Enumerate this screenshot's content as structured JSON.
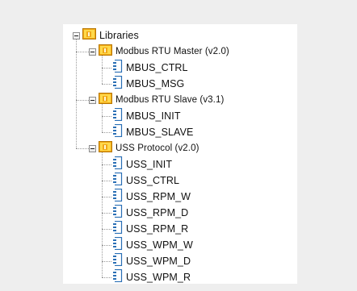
{
  "tree": {
    "root": {
      "label": "Libraries",
      "icon": "library-folder-icon",
      "expanded": true
    },
    "libraries": [
      {
        "label": "Modbus RTU Master (v2.0)",
        "icon": "library-folder-icon",
        "expanded": true,
        "blocks": [
          "MBUS_CTRL",
          "MBUS_MSG"
        ]
      },
      {
        "label": "Modbus RTU Slave (v3.1)",
        "icon": "library-folder-icon",
        "expanded": true,
        "blocks": [
          "MBUS_INIT",
          "MBUS_SLAVE"
        ]
      },
      {
        "label": "USS Protocol (v2.0)",
        "icon": "library-folder-icon",
        "expanded": true,
        "blocks": [
          "USS_INIT",
          "USS_CTRL",
          "USS_RPM_W",
          "USS_RPM_D",
          "USS_RPM_R",
          "USS_WPM_W",
          "USS_WPM_D",
          "USS_WPM_R"
        ]
      }
    ],
    "block_icon": "program-block-icon"
  },
  "colors": {
    "background": "#eeeeee",
    "panel": "#ffffff",
    "folder_orange": "#f0a818",
    "folder_yellow": "#ffd94a",
    "block_blue": "#2a6fb5"
  }
}
